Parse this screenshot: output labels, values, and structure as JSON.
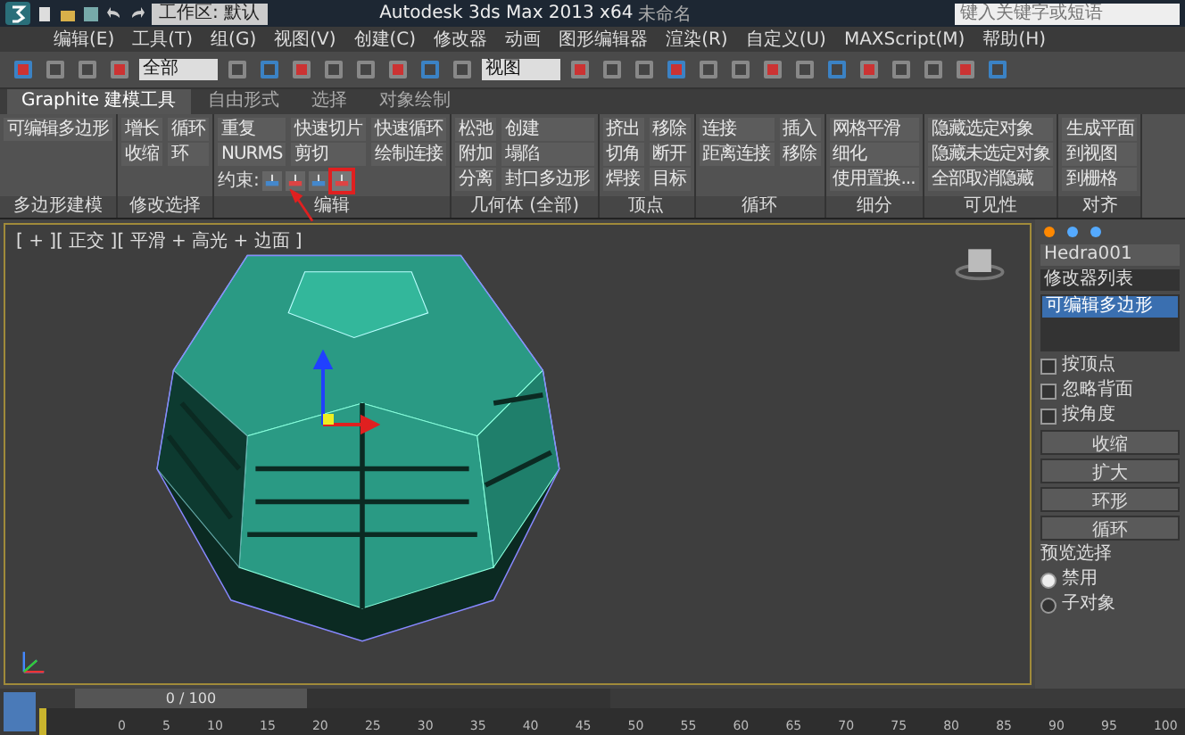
{
  "window": {
    "title": "Autodesk 3ds Max 2013 x64",
    "document": "未命名",
    "workspace": "工作区: 默认",
    "search": {
      "placeholder": "键入关键字或短语"
    }
  },
  "menu": [
    "编辑(E)",
    "工具(T)",
    "组(G)",
    "视图(V)",
    "创建(C)",
    "修改器",
    "动画",
    "图形编辑器",
    "渲染(R)",
    "自定义(U)",
    "MAXScript(M)",
    "帮助(H)"
  ],
  "toolbar": {
    "selection_filter": "全部",
    "reference_coord": "视图"
  },
  "ribbon": {
    "tabs": [
      {
        "label": "Graphite 建模工具",
        "selected": true
      },
      {
        "label": "自由形式",
        "selected": false
      },
      {
        "label": "选择",
        "selected": false
      },
      {
        "label": "对象绘制",
        "selected": false
      }
    ],
    "panels": [
      {
        "title": "多边形建模",
        "columns": [
          [
            {
              "kind": "text",
              "label": "可编辑多边形"
            }
          ]
        ]
      },
      {
        "title": "修改选择",
        "columns": [
          [
            {
              "kind": "text",
              "label": "增长"
            },
            {
              "kind": "text",
              "label": "收缩"
            }
          ],
          [
            {
              "kind": "text",
              "label": "循环"
            },
            {
              "kind": "text",
              "label": "环"
            }
          ]
        ]
      },
      {
        "title": "编辑",
        "columns": [
          [
            {
              "kind": "text",
              "label": "重复"
            },
            {
              "kind": "text",
              "label": "NURMS"
            }
          ],
          [
            {
              "kind": "text",
              "label": "快速切片"
            },
            {
              "kind": "text",
              "label": "剪切"
            }
          ],
          [
            {
              "kind": "text",
              "label": "快速循环"
            },
            {
              "kind": "text",
              "label": "绘制连接"
            }
          ]
        ],
        "constraints": {
          "label": "约束:",
          "icons": [
            {
              "highlighted": false
            },
            {
              "highlighted": false
            },
            {
              "highlighted": false
            },
            {
              "highlighted": true
            }
          ]
        }
      },
      {
        "title": "几何体 (全部)",
        "columns": [
          [
            {
              "kind": "text",
              "label": "松弛"
            },
            {
              "kind": "text",
              "label": "附加"
            },
            {
              "kind": "text",
              "label": "分离"
            }
          ],
          [
            {
              "kind": "text",
              "label": "创建"
            },
            {
              "kind": "text",
              "label": "塌陷"
            },
            {
              "kind": "text",
              "label": "封口多边形"
            }
          ]
        ]
      },
      {
        "title": "顶点",
        "columns": [
          [
            {
              "kind": "text",
              "label": "挤出"
            },
            {
              "kind": "text",
              "label": "切角"
            },
            {
              "kind": "text",
              "label": "焊接"
            }
          ],
          [
            {
              "kind": "text",
              "label": "移除"
            },
            {
              "kind": "text",
              "label": "断开"
            },
            {
              "kind": "text",
              "label": "目标"
            }
          ]
        ]
      },
      {
        "title": "循环",
        "columns": [
          [
            {
              "kind": "text",
              "label": "连接"
            },
            {
              "kind": "text",
              "label": "距离连接"
            }
          ],
          [
            {
              "kind": "text",
              "label": "插入"
            },
            {
              "kind": "text",
              "label": "移除"
            }
          ]
        ]
      },
      {
        "title": "细分",
        "columns": [
          [
            {
              "kind": "text",
              "label": "网格平滑"
            },
            {
              "kind": "text",
              "label": "细化"
            },
            {
              "kind": "text",
              "label": "使用置换..."
            }
          ]
        ]
      },
      {
        "title": "可见性",
        "columns": [
          [
            {
              "kind": "text",
              "label": "隐藏选定对象"
            },
            {
              "kind": "text",
              "label": "隐藏未选定对象"
            },
            {
              "kind": "text",
              "label": "全部取消隐藏"
            }
          ]
        ]
      },
      {
        "title": "对齐",
        "columns": [
          [
            {
              "kind": "text",
              "label": "生成平面"
            },
            {
              "kind": "text",
              "label": "到视图"
            },
            {
              "kind": "text",
              "label": "到栅格"
            }
          ]
        ]
      }
    ]
  },
  "viewport": {
    "label": "[ + ][ 正交 ][ 平滑 + 高光 + 边面 ]"
  },
  "command_panel": {
    "object_name": "Hedra001",
    "modifier_list": "修改器列表",
    "stack": [
      {
        "label": "可编辑多边形",
        "selected": true
      }
    ],
    "checkboxes": [
      {
        "label": "按顶点",
        "checked": false
      },
      {
        "label": "忽略背面",
        "checked": false
      },
      {
        "label": "按角度",
        "checked": false
      }
    ],
    "buttons": [
      "收缩",
      "扩大",
      "环形",
      "循环"
    ],
    "preview": {
      "title": "预览选择",
      "options": [
        {
          "label": "禁用",
          "selected": true
        },
        {
          "label": "子对象",
          "selected": false
        }
      ]
    }
  },
  "timeline": {
    "frame": "0 / 100",
    "level": 0,
    "ticks": [
      "0",
      "5",
      "10",
      "15",
      "20",
      "25",
      "30",
      "35",
      "40",
      "45",
      "50",
      "55",
      "60",
      "65",
      "70",
      "75",
      "80",
      "85",
      "90",
      "95",
      "100"
    ]
  }
}
